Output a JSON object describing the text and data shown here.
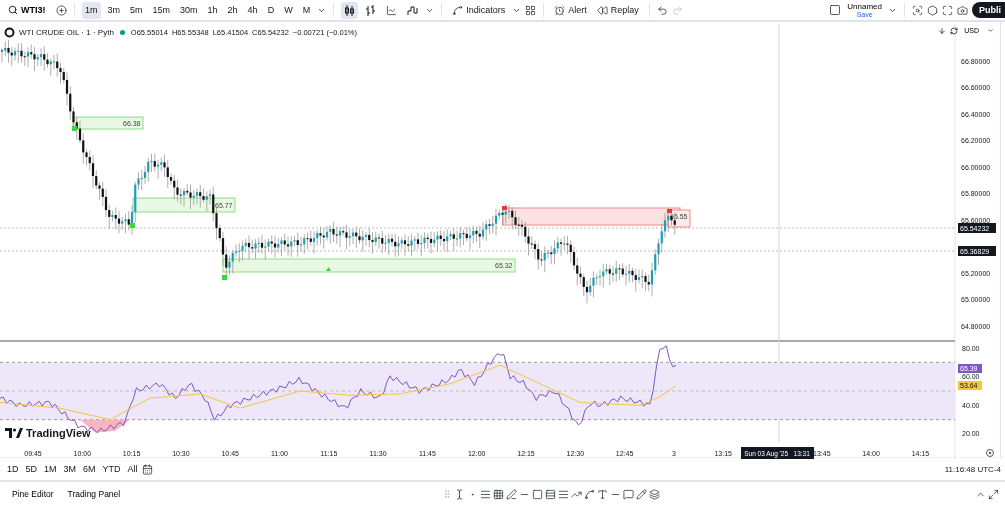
{
  "toolbar": {
    "symbol": "WTI3!",
    "intervals": [
      {
        "label": "1m",
        "selected": true
      },
      {
        "label": "3m",
        "selected": false
      },
      {
        "label": "5m",
        "selected": false
      },
      {
        "label": "15m",
        "selected": false
      },
      {
        "label": "30m",
        "selected": false
      },
      {
        "label": "1h",
        "selected": false
      },
      {
        "label": "2h",
        "selected": false
      },
      {
        "label": "4h",
        "selected": false
      },
      {
        "label": "D",
        "selected": false
      },
      {
        "label": "W",
        "selected": false
      },
      {
        "label": "M",
        "selected": false
      }
    ],
    "chart_types": [
      {
        "kind": "candles",
        "selected": true
      },
      {
        "kind": "bars",
        "selected": false
      },
      {
        "kind": "line",
        "selected": false
      },
      {
        "kind": "step",
        "selected": false
      }
    ],
    "indicators": "Indicators",
    "alert": "Alert",
    "replay": "Replay",
    "layout_name": "Unnamed",
    "layout_status": "Save",
    "publish": "Publi"
  },
  "legend": {
    "title": "WTI CRUDE OIL · 1 · Pyth",
    "market_open": true,
    "values": [
      "O65.55014",
      "H65.55348",
      "L65.41504",
      "C65.54232"
    ],
    "change": "−0.00721 (−0.01%)"
  },
  "currency": "USD",
  "price_axis": {
    "ticks": [
      "66.80000",
      "66.60000",
      "66.40000",
      "66.20000",
      "66.00000",
      "65.80000",
      "65.60000",
      "65.20000",
      "65.00000",
      "64.80000"
    ],
    "last_price": "65.54232",
    "crosshair_price": "65.36829"
  },
  "zones": [
    {
      "kind": "support",
      "label": "66.38"
    },
    {
      "kind": "support",
      "label": "65.77"
    },
    {
      "kind": "support",
      "label": "65.32"
    },
    {
      "kind": "resistance",
      "label": "65.55"
    }
  ],
  "rsi": {
    "ticks": [
      "80.00",
      "60.00",
      "40.00",
      "20.00"
    ],
    "rsi_value": "65.39",
    "ma_value": "53.64"
  },
  "time_axis": {
    "ticks": [
      "09:45",
      "10:00",
      "10:15",
      "10:30",
      "10:45",
      "11:00",
      "11:15",
      "11:30",
      "11:45",
      "12:00",
      "12:15",
      "12:30",
      "12:45",
      "3",
      "13:15",
      "13:45",
      "14:00",
      "14:15"
    ],
    "crosshair_time": "Sun 03 Aug '25   13:31"
  },
  "brand": "TradingView",
  "ranges": [
    "1D",
    "5D",
    "1M",
    "3M",
    "6M",
    "YTD",
    "All"
  ],
  "clock": "11:16:48 UTC-4",
  "bottom_tabs": [
    "Pine Editor",
    "Trading Panel"
  ]
}
